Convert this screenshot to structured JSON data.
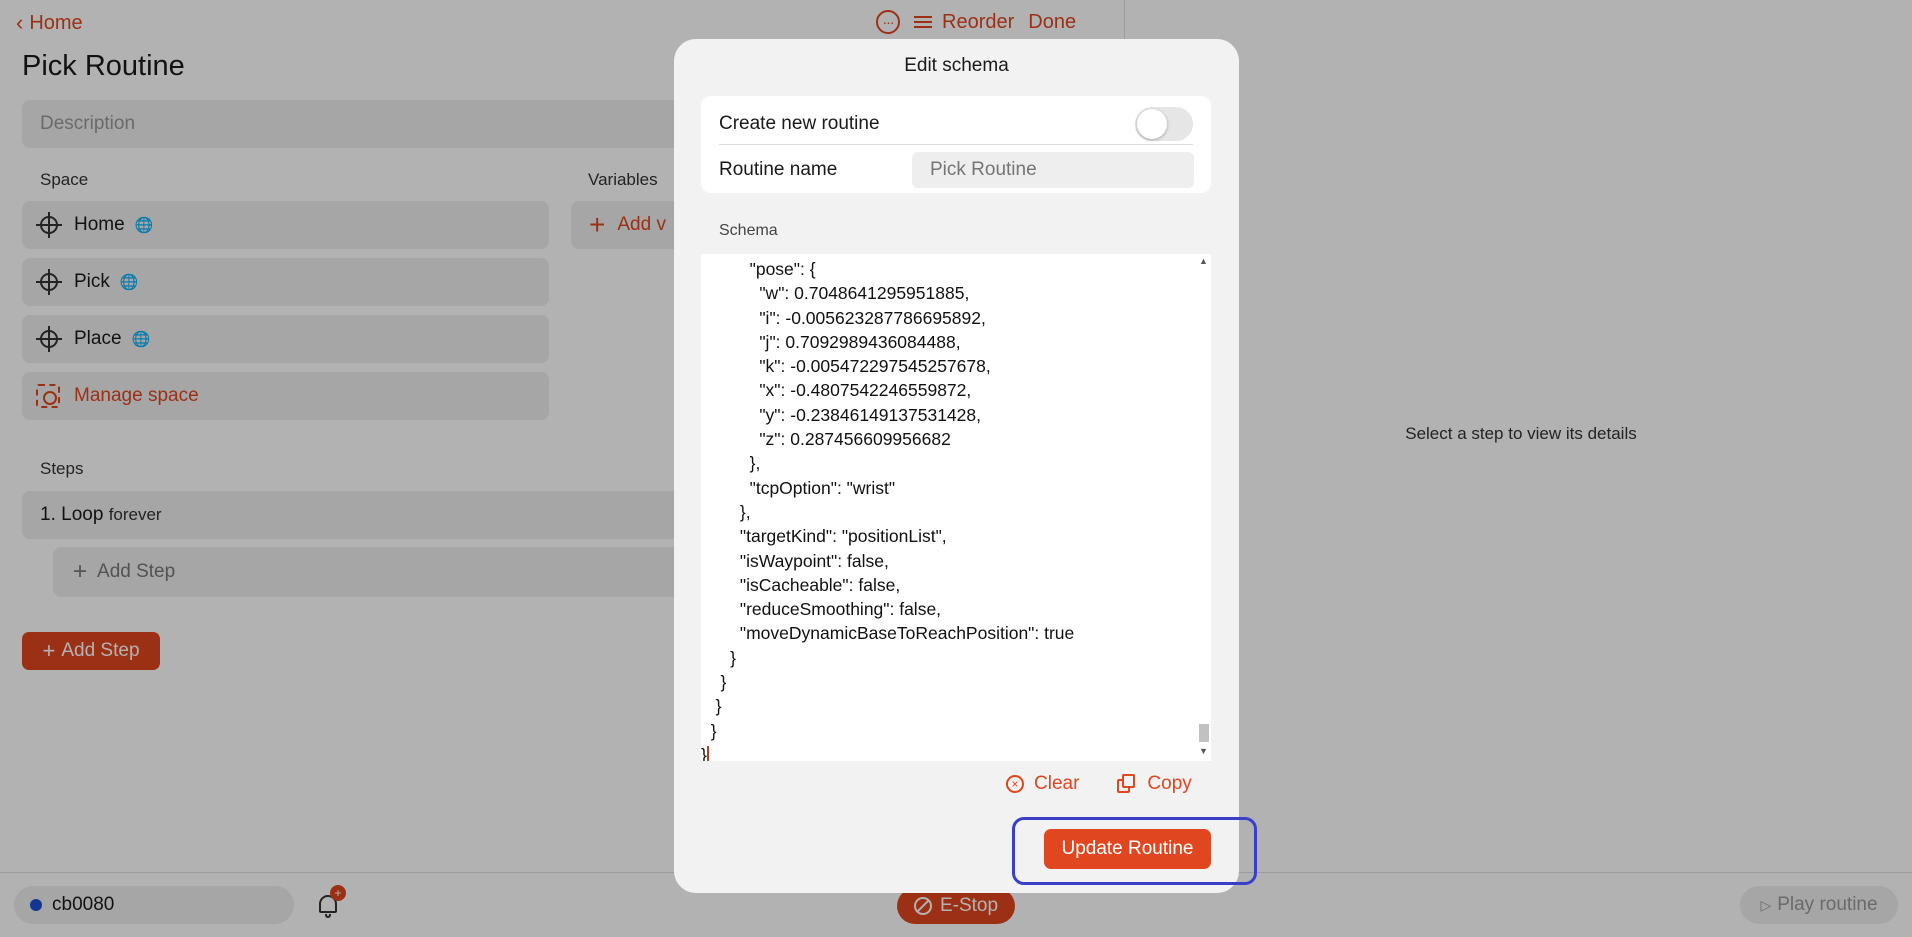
{
  "nav": {
    "back_label": "Home",
    "reorder_label": "Reorder",
    "done_label": "Done"
  },
  "page": {
    "title": "Pick Routine",
    "description_placeholder": "Description",
    "space_label": "Space",
    "variables_label": "Variables",
    "add_variable_label": "Add v",
    "steps_label": "Steps",
    "space_items": [
      "Home",
      "Pick",
      "Place"
    ],
    "manage_space_label": "Manage space",
    "loop": {
      "name": "1. Loop",
      "suffix": "forever"
    },
    "add_step_inner_label": "Add Step",
    "add_step_button_label": "Add Step"
  },
  "detail": {
    "message": "Select a step to view its details"
  },
  "footer": {
    "robot_name": "cb0080",
    "notification_count": "+",
    "estop_label": "E-Stop",
    "play_label": "Play routine"
  },
  "modal": {
    "title": "Edit schema",
    "create_new_label": "Create new routine",
    "create_new_on": false,
    "routine_name_label": "Routine name",
    "routine_name_placeholder": "Pick Routine",
    "schema_label": "Schema",
    "schema_lines": [
      "          \"pose\": {",
      "            \"w\": 0.7048641295951885,",
      "            \"i\": -0.005623287786695892,",
      "            \"j\": 0.7092989436084488,",
      "            \"k\": -0.005472297545257678,",
      "            \"x\": -0.4807542246559872,",
      "            \"y\": -0.23846149137531428,",
      "            \"z\": 0.287456609956682",
      "          },",
      "          \"tcpOption\": \"wrist\"",
      "        },",
      "        \"targetKind\": \"positionList\",",
      "        \"isWaypoint\": false,",
      "        \"isCacheable\": false,",
      "        \"reduceSmoothing\": false,",
      "        \"moveDynamicBaseToReachPosition\": true",
      "      }",
      "    }",
      "   }",
      "  }",
      "}"
    ],
    "clear_label": "Clear",
    "copy_label": "Copy",
    "update_label": "Update Routine"
  },
  "colors": {
    "accent": "#e0461f",
    "highlight": "#3a3fc9",
    "status_dot": "#1a4fd0"
  }
}
